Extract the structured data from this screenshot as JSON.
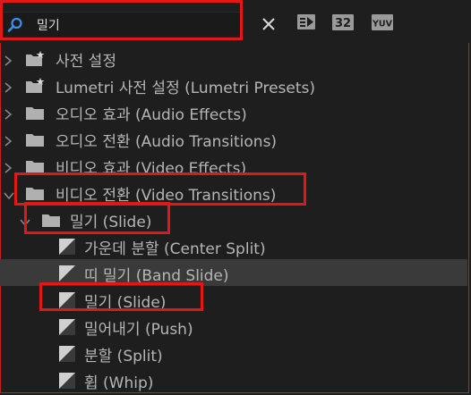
{
  "search": {
    "value": "밀기",
    "placeholder": ""
  },
  "toolbar": {
    "buttons": [
      {
        "name": "accelerated-effects",
        "icon": "accelerated-effects-icon"
      },
      {
        "name": "32-bit-color",
        "label": "32"
      },
      {
        "name": "yuv-effects",
        "label": "YUV"
      }
    ]
  },
  "tree": [
    {
      "label": "사전 설정",
      "type": "folder-presets",
      "expanded": false
    },
    {
      "label": "Lumetri 사전 설정 (Lumetri Presets)",
      "type": "folder-presets",
      "expanded": false
    },
    {
      "label": "오디오 효과 (Audio Effects)",
      "type": "folder",
      "expanded": false
    },
    {
      "label": "오디오 전환 (Audio Transitions)",
      "type": "folder",
      "expanded": false
    },
    {
      "label": "비디오 효과 (Video Effects)",
      "type": "folder",
      "expanded": false
    },
    {
      "label": "비디오 전환 (Video Transitions)",
      "type": "folder",
      "expanded": true
    },
    {
      "label": "밀기 (Slide)",
      "type": "folder",
      "expanded": true
    },
    {
      "label": "가운데 분할 (Center Split)",
      "type": "effect"
    },
    {
      "label": "띠 밀기 (Band Slide)",
      "type": "effect",
      "selected": true
    },
    {
      "label": "밀기 (Slide)",
      "type": "effect"
    },
    {
      "label": "밀어내기 (Push)",
      "type": "effect"
    },
    {
      "label": "분할 (Split)",
      "type": "effect"
    },
    {
      "label": "휩 (Whip)",
      "type": "effect"
    }
  ],
  "colors": {
    "highlight": "#e01818",
    "selected_row": "#3a3a3a",
    "search_icon": "#3a8ff0"
  }
}
